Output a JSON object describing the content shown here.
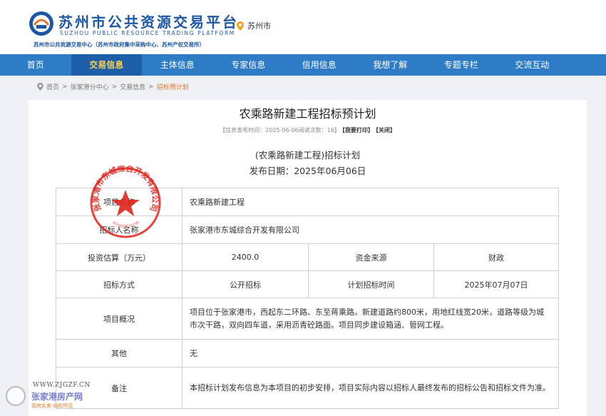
{
  "header": {
    "logo_cn": "苏州市公共资源交易平台",
    "logo_en": "SUZHOU PUBLIC RESOURCE TRADING PLATFORM",
    "logo_sub": "苏州市公共资源交易中心（苏州市政府集中采购中心、苏州产权交易所）",
    "location": "苏州市"
  },
  "nav": {
    "items": [
      {
        "label": "首页"
      },
      {
        "label": "交易信息"
      },
      {
        "label": "主体信息"
      },
      {
        "label": "专家信息"
      },
      {
        "label": "信用信息"
      },
      {
        "label": "我想了解"
      },
      {
        "label": "专题专栏"
      },
      {
        "label": "交流互动"
      }
    ],
    "active_index": 1
  },
  "breadcrumb": {
    "items": [
      "首页",
      "张家港分中心",
      "交易信息"
    ],
    "current": "招标预计划",
    "separator": ">"
  },
  "article": {
    "title": "农乘路新建工程招标预计划",
    "meta": "【信息发布时间：2025-06-06阅读次数：16】",
    "print_label": "【我要打印】",
    "close_label": "【关闭】",
    "subtitle": "(农乘路新建工程)招标计划",
    "publish_date": "发布日期：2025年06月06日"
  },
  "table": {
    "project_name_label": "项目名称",
    "project_name": "农乘路新建工程",
    "tenderer_label": "招标人名称",
    "tenderer": "张家港市东城综合开发有限公司",
    "investment_label": "投资估算（万元）",
    "investment": "2400.0",
    "fund_source_label": "资金来源",
    "fund_source": "财政",
    "method_label": "招标方式",
    "method": "公开招标",
    "plan_time_label": "计划招标时间",
    "plan_time": "2025年07月07日",
    "overview_label": "项目概况",
    "overview": "项目位于张家港市，西起东二环路、东至蒋乘路。新建道路约800米，用地红线宽20米，道路等级为城市次干路，双向四车道，采用沥青砼路面。项目同步建设箱涵、管网工程。",
    "other_label": "其他",
    "other": "无",
    "remark_label": "备注",
    "remark": "本招标计划发布信息为本项目的初步安排，项目实际内容以招标人最终发布的招标公告和招标文件为准。"
  },
  "seal": {
    "text": "张家港市东城综合开发有限公司",
    "code": "3205820025238",
    "color": "#e0241b"
  },
  "watermark": {
    "url": "WWW.ZJGZF.CN",
    "name": "张家港房产网",
    "slogan": "真房实卖·如你所见"
  },
  "colors": {
    "nav_bg": "#2f7cc6",
    "nav_active_bg": "#1c5ea8",
    "nav_active_text": "#ffd24a",
    "brand": "#1c57a6",
    "accent": "#e5762c"
  }
}
